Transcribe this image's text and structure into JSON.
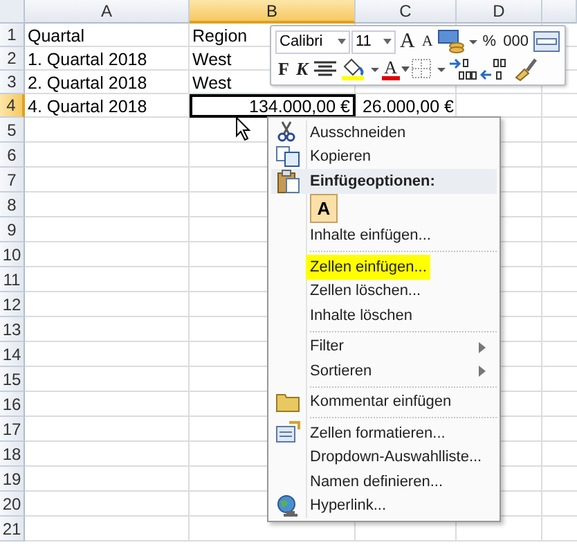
{
  "sheet": {
    "columns": [
      {
        "label": "A",
        "selected": false
      },
      {
        "label": "B",
        "selected": true
      },
      {
        "label": "C",
        "selected": false
      },
      {
        "label": "D",
        "selected": false
      }
    ],
    "rows": [
      {
        "header": "1",
        "selected": false,
        "cells": [
          {
            "text": "Quartal",
            "kind": "text",
            "selected": false
          },
          {
            "text": "Region",
            "kind": "text",
            "selected": false
          }
        ]
      },
      {
        "header": "2",
        "selected": false,
        "cells": [
          {
            "text": "1. Quartal 2018",
            "kind": "text",
            "selected": false
          },
          {
            "text": "West",
            "kind": "text",
            "selected": false
          }
        ]
      },
      {
        "header": "3",
        "selected": false,
        "cells": [
          {
            "text": "2. Quartal 2018",
            "kind": "text",
            "selected": false
          },
          {
            "text": "West",
            "kind": "text",
            "selected": false
          }
        ]
      },
      {
        "header": "4",
        "selected": true,
        "cells": [
          {
            "text": "4. Quartal 2018",
            "kind": "text",
            "selected": false
          },
          {
            "text": "134.000,00 €",
            "kind": "number",
            "selected": true
          },
          {
            "text": "26.000,00 €",
            "kind": "number",
            "selected": false
          }
        ]
      },
      {
        "header": "5",
        "selected": false,
        "cells": []
      },
      {
        "header": "6",
        "selected": false,
        "cells": []
      },
      {
        "header": "7",
        "selected": false,
        "cells": []
      },
      {
        "header": "8",
        "selected": false,
        "cells": []
      },
      {
        "header": "9",
        "selected": false,
        "cells": []
      },
      {
        "header": "10",
        "selected": false,
        "cells": []
      },
      {
        "header": "11",
        "selected": false,
        "cells": []
      },
      {
        "header": "12",
        "selected": false,
        "cells": []
      },
      {
        "header": "13",
        "selected": false,
        "cells": []
      },
      {
        "header": "14",
        "selected": false,
        "cells": []
      },
      {
        "header": "15",
        "selected": false,
        "cells": []
      },
      {
        "header": "16",
        "selected": false,
        "cells": []
      },
      {
        "header": "17",
        "selected": false,
        "cells": []
      },
      {
        "header": "18",
        "selected": false,
        "cells": []
      },
      {
        "header": "19",
        "selected": false,
        "cells": []
      },
      {
        "header": "20",
        "selected": false,
        "cells": []
      },
      {
        "header": "21",
        "selected": false,
        "cells": []
      }
    ]
  },
  "mini_toolbar": {
    "font": "Calibri",
    "size": "11",
    "row_1": [
      {
        "kind": "grow",
        "text": "A"
      },
      {
        "kind": "shrink",
        "text": "A"
      },
      {
        "kind": "accounting"
      },
      {
        "kind": "glyph",
        "text": "%"
      },
      {
        "kind": "glyph",
        "text": "000"
      },
      {
        "kind": "merge"
      }
    ],
    "row_2": [
      {
        "kind": "bold",
        "text": "F"
      },
      {
        "kind": "italic",
        "text": "K"
      },
      {
        "kind": "center"
      },
      {
        "kind": "fill-color"
      },
      {
        "kind": "font-color",
        "text": "A"
      },
      {
        "kind": "borders"
      },
      {
        "kind": "inc-decimal"
      },
      {
        "kind": "dec-decimal"
      },
      {
        "kind": "painter"
      }
    ]
  },
  "context_menu": [
    {
      "kind": "item",
      "label": "Ausschneiden",
      "highlighted": false
    },
    {
      "kind": "item",
      "label": "Kopieren",
      "highlighted": false
    },
    {
      "kind": "header",
      "label": "Einfügeoptionen:"
    },
    {
      "kind": "paste",
      "label": "A"
    },
    {
      "kind": "item",
      "label": "Inhalte einfügen...",
      "highlighted": false
    },
    {
      "kind": "separator"
    },
    {
      "kind": "item",
      "label": "Zellen einfügen...",
      "highlighted": true
    },
    {
      "kind": "item",
      "label": "Zellen löschen...",
      "highlighted": false
    },
    {
      "kind": "item",
      "label": "Inhalte löschen",
      "highlighted": false
    },
    {
      "kind": "separator"
    },
    {
      "kind": "submenu",
      "label": "Filter",
      "highlighted": false
    },
    {
      "kind": "submenu",
      "label": "Sortieren",
      "highlighted": false
    },
    {
      "kind": "separator"
    },
    {
      "kind": "item",
      "label": "Kommentar einfügen",
      "highlighted": false
    },
    {
      "kind": "separator"
    },
    {
      "kind": "item",
      "label": "Zellen formatieren...",
      "highlighted": false
    },
    {
      "kind": "item",
      "label": "Dropdown-Auswahlliste...",
      "highlighted": false
    },
    {
      "kind": "item",
      "label": "Namen definieren...",
      "highlighted": false
    },
    {
      "kind": "item",
      "label": "Hyperlink...",
      "highlighted": false
    }
  ]
}
